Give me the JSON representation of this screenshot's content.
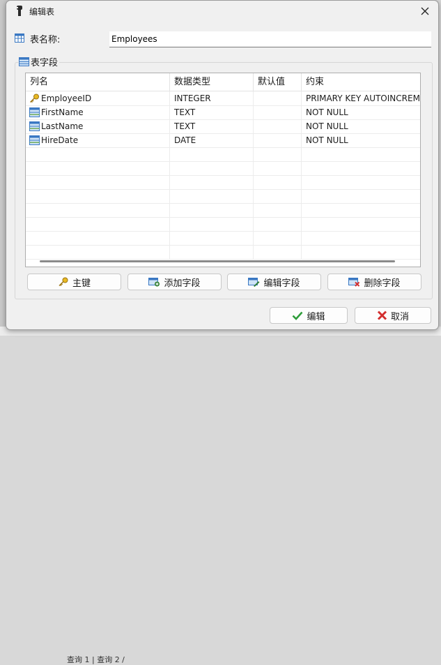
{
  "background": {
    "tabs": "查询 1 | 查询 2 /"
  },
  "dialog": {
    "title": "编辑表"
  },
  "table_name": {
    "label": "表名称:",
    "value": "Employees"
  },
  "fields_group": {
    "title": "表字段"
  },
  "grid": {
    "columns": [
      "列名",
      "数据类型",
      "默认值",
      "约束"
    ],
    "rows": [
      {
        "name": "EmployeeID",
        "type": "INTEGER",
        "default": "",
        "constraint": "PRIMARY KEY AUTOINCREMENT",
        "icon": "key-icon"
      },
      {
        "name": "FirstName",
        "type": "TEXT",
        "default": "",
        "constraint": "NOT NULL",
        "icon": "field-icon"
      },
      {
        "name": "LastName",
        "type": "TEXT",
        "default": "",
        "constraint": "NOT NULL",
        "icon": "field-icon"
      },
      {
        "name": "HireDate",
        "type": "DATE",
        "default": "",
        "constraint": "NOT NULL",
        "icon": "field-icon"
      }
    ]
  },
  "buttons": {
    "primary_key": "主键",
    "add_field": "添加字段",
    "edit_field": "编辑字段",
    "delete_field": "删除字段",
    "ok": "编辑",
    "cancel": "取消"
  },
  "colors": {
    "accent": "#2e7d32",
    "danger": "#d32f2f",
    "key": "#d4a017",
    "field": "#3a78c3"
  }
}
